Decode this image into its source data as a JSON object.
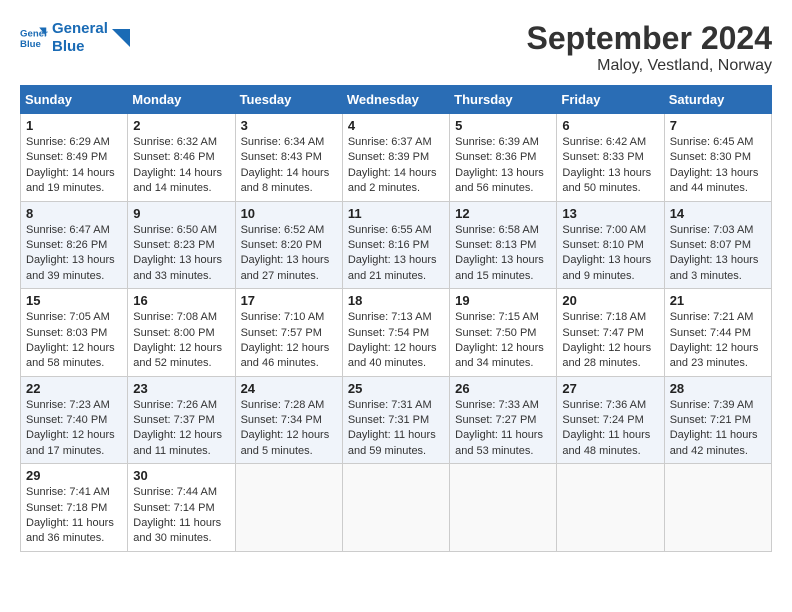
{
  "header": {
    "logo_line1": "General",
    "logo_line2": "Blue",
    "title": "September 2024",
    "subtitle": "Maloy, Vestland, Norway"
  },
  "weekdays": [
    "Sunday",
    "Monday",
    "Tuesday",
    "Wednesday",
    "Thursday",
    "Friday",
    "Saturday"
  ],
  "weeks": [
    [
      {
        "day": "1",
        "detail": "Sunrise: 6:29 AM\nSunset: 8:49 PM\nDaylight: 14 hours\nand 19 minutes."
      },
      {
        "day": "2",
        "detail": "Sunrise: 6:32 AM\nSunset: 8:46 PM\nDaylight: 14 hours\nand 14 minutes."
      },
      {
        "day": "3",
        "detail": "Sunrise: 6:34 AM\nSunset: 8:43 PM\nDaylight: 14 hours\nand 8 minutes."
      },
      {
        "day": "4",
        "detail": "Sunrise: 6:37 AM\nSunset: 8:39 PM\nDaylight: 14 hours\nand 2 minutes."
      },
      {
        "day": "5",
        "detail": "Sunrise: 6:39 AM\nSunset: 8:36 PM\nDaylight: 13 hours\nand 56 minutes."
      },
      {
        "day": "6",
        "detail": "Sunrise: 6:42 AM\nSunset: 8:33 PM\nDaylight: 13 hours\nand 50 minutes."
      },
      {
        "day": "7",
        "detail": "Sunrise: 6:45 AM\nSunset: 8:30 PM\nDaylight: 13 hours\nand 44 minutes."
      }
    ],
    [
      {
        "day": "8",
        "detail": "Sunrise: 6:47 AM\nSunset: 8:26 PM\nDaylight: 13 hours\nand 39 minutes."
      },
      {
        "day": "9",
        "detail": "Sunrise: 6:50 AM\nSunset: 8:23 PM\nDaylight: 13 hours\nand 33 minutes."
      },
      {
        "day": "10",
        "detail": "Sunrise: 6:52 AM\nSunset: 8:20 PM\nDaylight: 13 hours\nand 27 minutes."
      },
      {
        "day": "11",
        "detail": "Sunrise: 6:55 AM\nSunset: 8:16 PM\nDaylight: 13 hours\nand 21 minutes."
      },
      {
        "day": "12",
        "detail": "Sunrise: 6:58 AM\nSunset: 8:13 PM\nDaylight: 13 hours\nand 15 minutes."
      },
      {
        "day": "13",
        "detail": "Sunrise: 7:00 AM\nSunset: 8:10 PM\nDaylight: 13 hours\nand 9 minutes."
      },
      {
        "day": "14",
        "detail": "Sunrise: 7:03 AM\nSunset: 8:07 PM\nDaylight: 13 hours\nand 3 minutes."
      }
    ],
    [
      {
        "day": "15",
        "detail": "Sunrise: 7:05 AM\nSunset: 8:03 PM\nDaylight: 12 hours\nand 58 minutes."
      },
      {
        "day": "16",
        "detail": "Sunrise: 7:08 AM\nSunset: 8:00 PM\nDaylight: 12 hours\nand 52 minutes."
      },
      {
        "day": "17",
        "detail": "Sunrise: 7:10 AM\nSunset: 7:57 PM\nDaylight: 12 hours\nand 46 minutes."
      },
      {
        "day": "18",
        "detail": "Sunrise: 7:13 AM\nSunset: 7:54 PM\nDaylight: 12 hours\nand 40 minutes."
      },
      {
        "day": "19",
        "detail": "Sunrise: 7:15 AM\nSunset: 7:50 PM\nDaylight: 12 hours\nand 34 minutes."
      },
      {
        "day": "20",
        "detail": "Sunrise: 7:18 AM\nSunset: 7:47 PM\nDaylight: 12 hours\nand 28 minutes."
      },
      {
        "day": "21",
        "detail": "Sunrise: 7:21 AM\nSunset: 7:44 PM\nDaylight: 12 hours\nand 23 minutes."
      }
    ],
    [
      {
        "day": "22",
        "detail": "Sunrise: 7:23 AM\nSunset: 7:40 PM\nDaylight: 12 hours\nand 17 minutes."
      },
      {
        "day": "23",
        "detail": "Sunrise: 7:26 AM\nSunset: 7:37 PM\nDaylight: 12 hours\nand 11 minutes."
      },
      {
        "day": "24",
        "detail": "Sunrise: 7:28 AM\nSunset: 7:34 PM\nDaylight: 12 hours\nand 5 minutes."
      },
      {
        "day": "25",
        "detail": "Sunrise: 7:31 AM\nSunset: 7:31 PM\nDaylight: 11 hours\nand 59 minutes."
      },
      {
        "day": "26",
        "detail": "Sunrise: 7:33 AM\nSunset: 7:27 PM\nDaylight: 11 hours\nand 53 minutes."
      },
      {
        "day": "27",
        "detail": "Sunrise: 7:36 AM\nSunset: 7:24 PM\nDaylight: 11 hours\nand 48 minutes."
      },
      {
        "day": "28",
        "detail": "Sunrise: 7:39 AM\nSunset: 7:21 PM\nDaylight: 11 hours\nand 42 minutes."
      }
    ],
    [
      {
        "day": "29",
        "detail": "Sunrise: 7:41 AM\nSunset: 7:18 PM\nDaylight: 11 hours\nand 36 minutes."
      },
      {
        "day": "30",
        "detail": "Sunrise: 7:44 AM\nSunset: 7:14 PM\nDaylight: 11 hours\nand 30 minutes."
      },
      {
        "day": "",
        "detail": ""
      },
      {
        "day": "",
        "detail": ""
      },
      {
        "day": "",
        "detail": ""
      },
      {
        "day": "",
        "detail": ""
      },
      {
        "day": "",
        "detail": ""
      }
    ]
  ]
}
